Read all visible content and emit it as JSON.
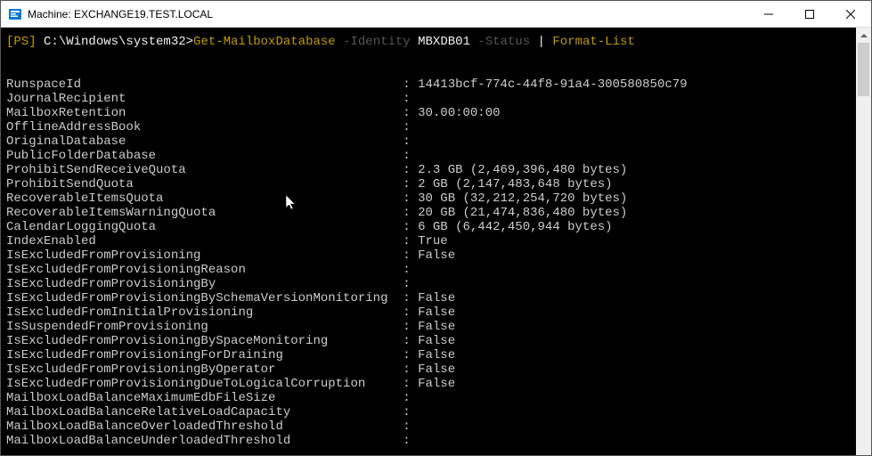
{
  "window": {
    "title": "Machine: EXCHANGE19.TEST.LOCAL"
  },
  "prompt": {
    "prefix": "[PS]",
    "path": " C:\\Windows\\system32>",
    "cmd": "Get-MailboxDatabase",
    "flag1": " -Identity ",
    "arg1": "MBXDB01",
    "flag2": " -Status ",
    "pipe": "| ",
    "cmd2": "Format-List"
  },
  "rows": [
    {
      "k": "RunspaceId",
      "v": "14413bcf-774c-44f8-91a4-300580850c79"
    },
    {
      "k": "JournalRecipient",
      "v": ""
    },
    {
      "k": "MailboxRetention",
      "v": "30.00:00:00"
    },
    {
      "k": "OfflineAddressBook",
      "v": ""
    },
    {
      "k": "OriginalDatabase",
      "v": ""
    },
    {
      "k": "PublicFolderDatabase",
      "v": ""
    },
    {
      "k": "ProhibitSendReceiveQuota",
      "v": "2.3 GB (2,469,396,480 bytes)"
    },
    {
      "k": "ProhibitSendQuota",
      "v": "2 GB (2,147,483,648 bytes)"
    },
    {
      "k": "RecoverableItemsQuota",
      "v": "30 GB (32,212,254,720 bytes)"
    },
    {
      "k": "RecoverableItemsWarningQuota",
      "v": "20 GB (21,474,836,480 bytes)"
    },
    {
      "k": "CalendarLoggingQuota",
      "v": "6 GB (6,442,450,944 bytes)"
    },
    {
      "k": "IndexEnabled",
      "v": "True"
    },
    {
      "k": "IsExcludedFromProvisioning",
      "v": "False"
    },
    {
      "k": "IsExcludedFromProvisioningReason",
      "v": ""
    },
    {
      "k": "IsExcludedFromProvisioningBy",
      "v": ""
    },
    {
      "k": "IsExcludedFromProvisioningBySchemaVersionMonitoring",
      "v": "False"
    },
    {
      "k": "IsExcludedFromInitialProvisioning",
      "v": "False"
    },
    {
      "k": "IsSuspendedFromProvisioning",
      "v": "False"
    },
    {
      "k": "IsExcludedFromProvisioningBySpaceMonitoring",
      "v": "False"
    },
    {
      "k": "IsExcludedFromProvisioningForDraining",
      "v": "False"
    },
    {
      "k": "IsExcludedFromProvisioningByOperator",
      "v": "False"
    },
    {
      "k": "IsExcludedFromProvisioningDueToLogicalCorruption",
      "v": "False"
    },
    {
      "k": "MailboxLoadBalanceMaximumEdbFileSize",
      "v": ""
    },
    {
      "k": "MailboxLoadBalanceRelativeLoadCapacity",
      "v": ""
    },
    {
      "k": "MailboxLoadBalanceOverloadedThreshold",
      "v": ""
    },
    {
      "k": "MailboxLoadBalanceUnderloadedThreshold",
      "v": ""
    }
  ]
}
